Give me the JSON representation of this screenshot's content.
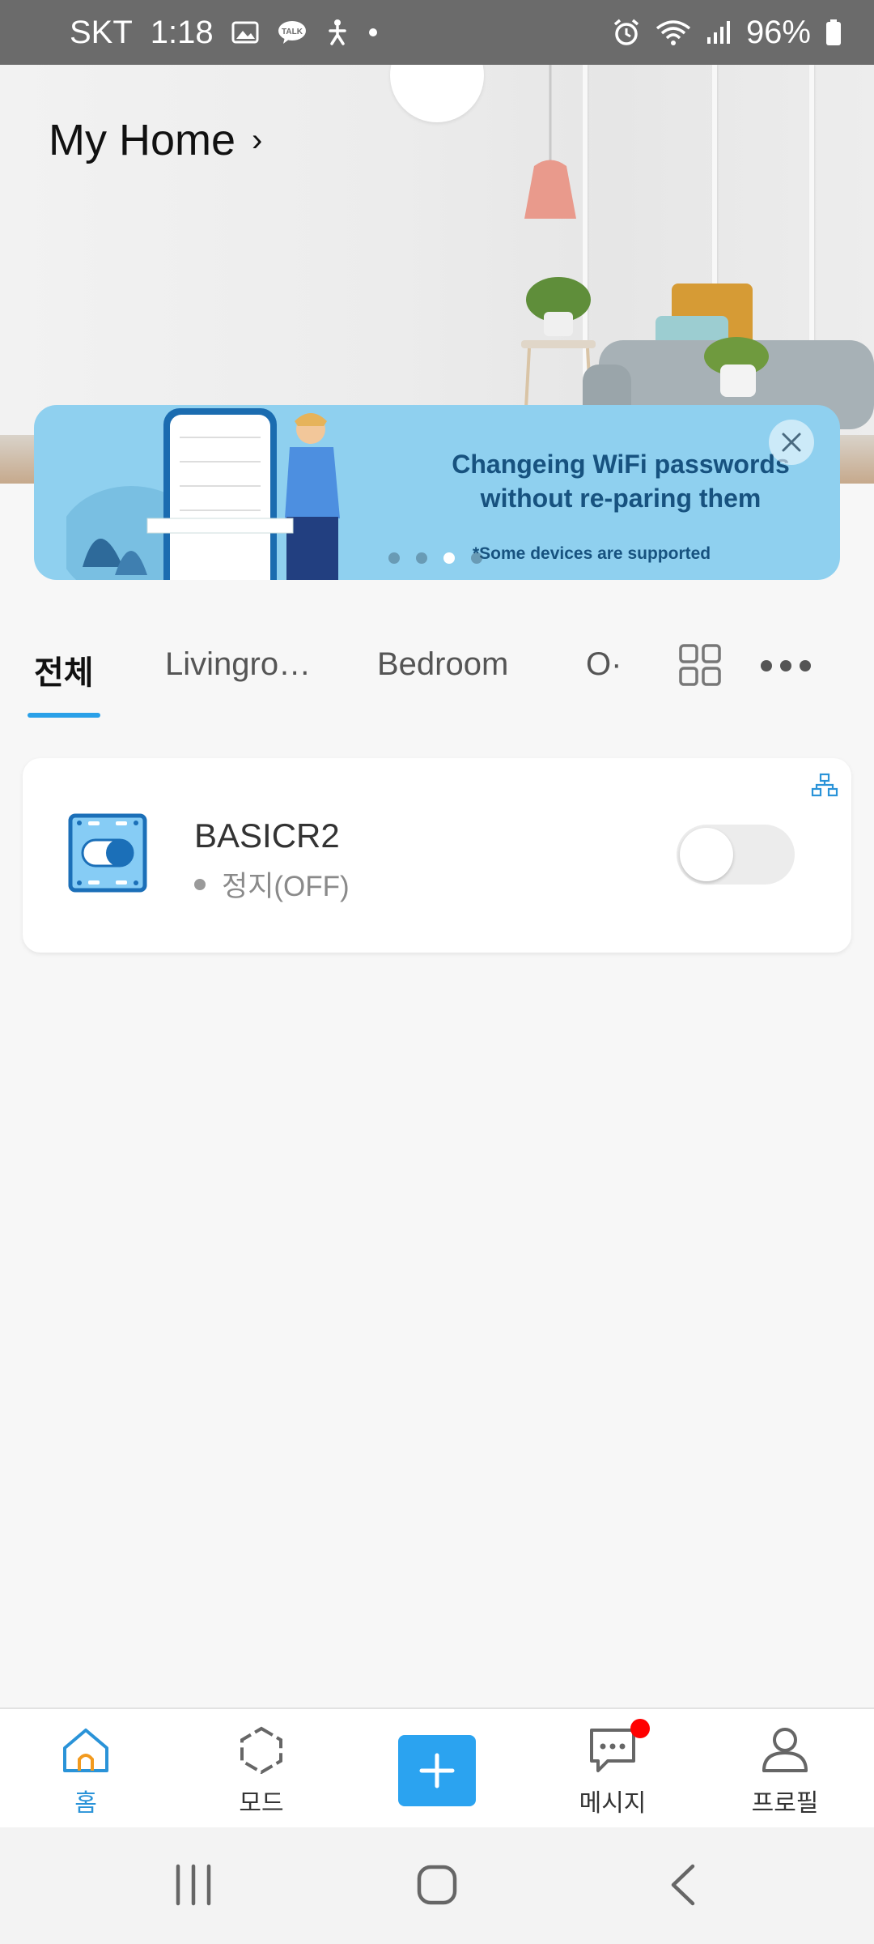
{
  "status_bar": {
    "carrier": "SKT",
    "time": "1:18",
    "notification_icons": [
      "image-icon",
      "kakaotalk-icon",
      "accessibility-icon",
      "dot-icon"
    ],
    "system_icons": [
      "alarm-icon",
      "wifi-icon",
      "signal-icon",
      "battery-icon"
    ],
    "battery": "96%"
  },
  "header": {
    "home_name": "My Home",
    "chevron": "›"
  },
  "banner": {
    "line1": "Changeing WiFi passwords",
    "line2": "without re-paring them",
    "note": "*Some devices are supported",
    "page_count": 4,
    "active_page": 3,
    "close_icon": "close-icon",
    "bg_color": "#8fd0ef",
    "text_color": "#17527f"
  },
  "tabs": {
    "items": [
      {
        "label": "전체",
        "active": true
      },
      {
        "label": "Livingro…",
        "active": false
      },
      {
        "label": "Bedroom",
        "active": false
      },
      {
        "label": "O·",
        "active": false
      }
    ],
    "grid_icon": "grid-view-icon",
    "more_icon": "more-icon",
    "accent_color": "#2aa0e8"
  },
  "devices": [
    {
      "name": "BASICR2",
      "status": "정지(OFF)",
      "icon": "switch-device-icon",
      "power_on": false,
      "network_icon": "network-topology-icon"
    }
  ],
  "bottom_nav": {
    "items": [
      {
        "label": "홈",
        "icon": "home-icon",
        "active": true
      },
      {
        "label": "모드",
        "icon": "mode-icon",
        "active": false
      },
      {
        "label": "",
        "icon": "add-icon",
        "active": false
      },
      {
        "label": "메시지",
        "icon": "message-icon",
        "active": false,
        "badge": true
      },
      {
        "label": "프로필",
        "icon": "profile-icon",
        "active": false
      }
    ],
    "add_color": "#2ba3f0"
  },
  "system_nav": {
    "buttons": [
      "recent-apps-icon",
      "home-circle-icon",
      "back-icon"
    ]
  }
}
